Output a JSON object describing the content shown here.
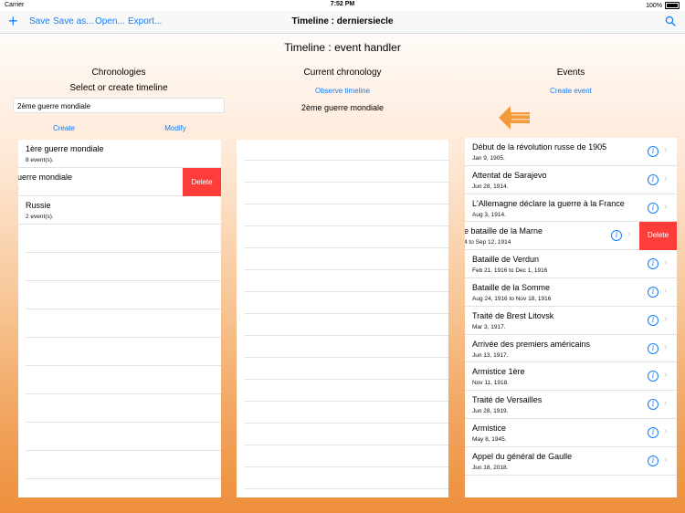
{
  "status_bar": {
    "carrier": "Carrier",
    "time": "7:52 PM",
    "battery": "100%"
  },
  "navbar": {
    "save": "Save",
    "save_as": "Save as...",
    "open": "Open...",
    "export": "Export...",
    "title": "Timeline : derniersiecle"
  },
  "main_title": "Timeline : event handler",
  "chronologies": {
    "title": "Chronologies",
    "subtitle": "Select or create timeline",
    "input_value": "2ème guerre mondiale",
    "create": "Create",
    "modify": "Modify",
    "items": [
      {
        "title": "1ère guerre mondiale",
        "subtitle": "8 event(s)."
      },
      {
        "title": "uerre mondiale",
        "subtitle": "."
      },
      {
        "title": "Russie",
        "subtitle": "2 event(s)."
      }
    ],
    "delete_label": "Delete"
  },
  "current": {
    "title": "Current chronology",
    "observe": "Observe timeline",
    "name": "2ème guerre mondiale"
  },
  "events": {
    "title": "Events",
    "create": "Create event",
    "delete_label": "Delete",
    "items": [
      {
        "title": "Début de la révolution russe de 1905",
        "subtitle": "Jan 9, 1905."
      },
      {
        "title": "Attentat de Sarajevo",
        "subtitle": "Jun 28, 1914."
      },
      {
        "title": "L'Allemagne déclare la guerre à la France",
        "subtitle": "Aug 3, 1914."
      },
      {
        "title": "e bataille de la Marne",
        "subtitle": "4 to Sep 12, 1914"
      },
      {
        "title": "Bataille de Verdun",
        "subtitle": "Feb 21, 1916 to Dec 1, 1916"
      },
      {
        "title": "Bataille de la Somme",
        "subtitle": "Aug 24, 1916 to Nov 18, 1916"
      },
      {
        "title": "Traité de Brest Litovsk",
        "subtitle": "Mar 3, 1917."
      },
      {
        "title": "Arrivée des premiers américains",
        "subtitle": "Jun 13, 1917."
      },
      {
        "title": "Armistice 1ère",
        "subtitle": "Nov 11, 1918."
      },
      {
        "title": "Traité de Versailles",
        "subtitle": "Jun 28, 1919."
      },
      {
        "title": "Armistice",
        "subtitle": "May 8, 1945."
      },
      {
        "title": "Appel du général de Gaulle",
        "subtitle": "Jun 18, 2018."
      }
    ]
  },
  "colors": {
    "accent": "#147efb",
    "delete": "#fc3d39",
    "arrow": "#f39a3c"
  }
}
